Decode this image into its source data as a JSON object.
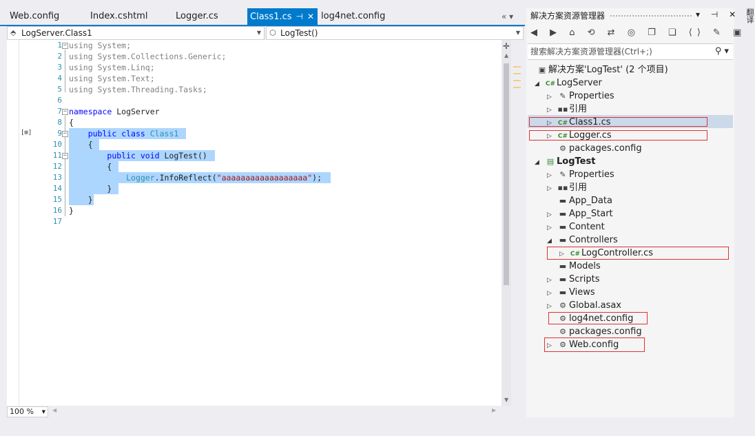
{
  "tabs": [
    {
      "label": "Web.config"
    },
    {
      "label": "Index.cshtml"
    },
    {
      "label": "Logger.cs"
    },
    {
      "label": "Class1.cs",
      "pin": "⊣",
      "close": "✕"
    },
    {
      "label": "log4net.config"
    }
  ],
  "tab_nav": "« ▾",
  "nav": {
    "class_dropdown": "LogServer.Class1",
    "member_dropdown": "LogTest()"
  },
  "code": {
    "line_numbers": [
      "1",
      "2",
      "3",
      "4",
      "5",
      "6",
      "7",
      "8",
      "9",
      "10",
      "11",
      "12",
      "13",
      "14",
      "15",
      "16",
      "17"
    ],
    "lines": [
      "using System;",
      "using System.Collections.Generic;",
      "using System.Linq;",
      "using System.Text;",
      "using System.Threading.Tasks;",
      "",
      "namespace LogServer",
      "{",
      "    public class Class1",
      "    {",
      "        public void LogTest()",
      "        {",
      "            Logger.InfoReflect(\"aaaaaaaaaaaaaaaaaa\");",
      "        }",
      "    }",
      "}",
      ""
    ],
    "kw_public": "public",
    "kw_class": "class",
    "kw_void": "void",
    "kw_namespace": "namespace",
    "type_class1": "Class1",
    "type_logger": "Logger",
    "method_infoReflect": ".InfoReflect(",
    "string_literal": "\"aaaaaaaaaaaaaaaaaa\"",
    "end_paren": ");",
    "ns_name": " LogServer",
    "method_name": " LogTest()",
    "side_glyph": "[⊞]"
  },
  "zoom": "100 %",
  "solution_explorer": {
    "title": "解决方案资源管理器",
    "title_controls": "▾ ⊣ ✕",
    "toolbar": "◀ ▶ ⌂ ⟲ ⇄ ◎ ❐ ❏ ⟨⟩ ✎ ▣",
    "search_placeholder": "搜索解决方案资源管理器(Ctrl+;)",
    "search_icon": "⚲ ▾",
    "tree": [
      {
        "label": "解决方案'LogTest' (2 个项目)"
      },
      {
        "label": "LogServer"
      },
      {
        "label": "Properties"
      },
      {
        "label": "引用"
      },
      {
        "label": "Class1.cs"
      },
      {
        "label": "Logger.cs"
      },
      {
        "label": "packages.config"
      },
      {
        "label": "LogTest"
      },
      {
        "label": "Properties"
      },
      {
        "label": "引用"
      },
      {
        "label": "App_Data"
      },
      {
        "label": "App_Start"
      },
      {
        "label": "Content"
      },
      {
        "label": "Controllers"
      },
      {
        "label": "LogController.cs"
      },
      {
        "label": "Models"
      },
      {
        "label": "Scripts"
      },
      {
        "label": "Views"
      },
      {
        "label": "Global.asax"
      },
      {
        "label": "log4net.config"
      },
      {
        "label": "packages.config"
      },
      {
        "label": "Web.config"
      }
    ],
    "cs_badge": "C#"
  },
  "right_strip": "翻译"
}
